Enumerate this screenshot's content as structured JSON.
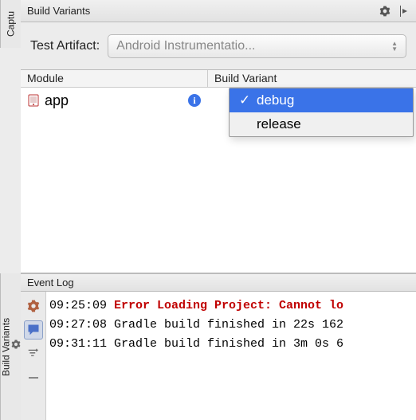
{
  "left_tabs": {
    "top": "Captu",
    "bottom": "Build Variants"
  },
  "panel": {
    "title": "Build Variants"
  },
  "artifact": {
    "label": "Test Artifact:",
    "selected": "Android Instrumentatio..."
  },
  "table": {
    "columns": [
      "Module",
      "Build Variant"
    ],
    "rows": [
      {
        "module": "app",
        "variant": "debug"
      }
    ]
  },
  "variant_options": [
    {
      "label": "debug",
      "selected": true
    },
    {
      "label": "release",
      "selected": false
    }
  ],
  "event_log": {
    "title": "Event Log",
    "entries": [
      {
        "time": "09:25:09",
        "type": "error",
        "message": "Error Loading Project: Cannot lo"
      },
      {
        "time": "09:27:08",
        "type": "info",
        "message": "Gradle build finished in 22s 162"
      },
      {
        "time": "09:31:11",
        "type": "info",
        "message": "Gradle build finished in 3m 0s 6"
      }
    ]
  }
}
